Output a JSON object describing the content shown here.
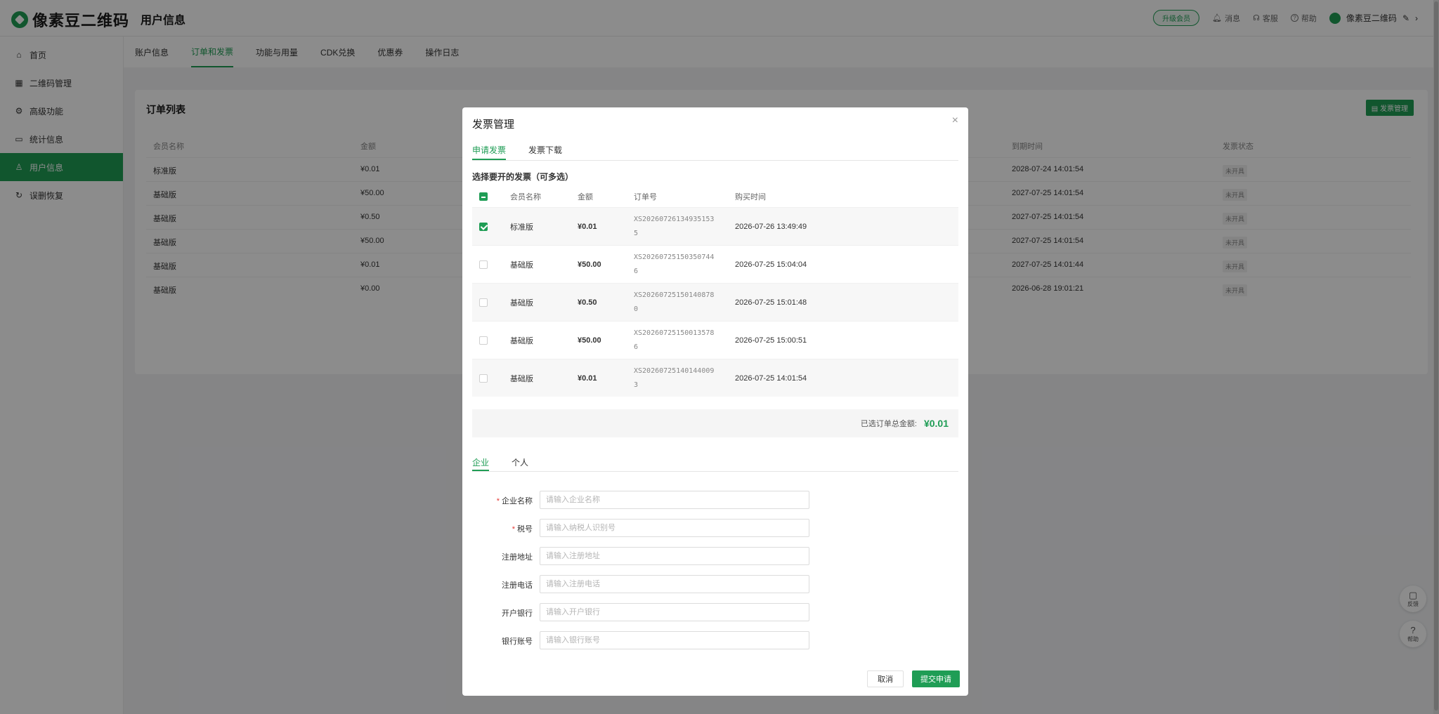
{
  "app": {
    "brand": "像素豆二维码",
    "page_title": "用户信息"
  },
  "topbar": {
    "upgrade": "升级会员",
    "message": "消息",
    "service": "客服",
    "help": "帮助",
    "user_name": "像素豆二维码"
  },
  "sidebar": {
    "items": [
      {
        "label": "首页",
        "icon": "home-icon"
      },
      {
        "label": "二维码管理",
        "icon": "grid-icon"
      },
      {
        "label": "高级功能",
        "icon": "gear-icon"
      },
      {
        "label": "统计信息",
        "icon": "chart-icon"
      },
      {
        "label": "用户信息",
        "icon": "user-icon"
      },
      {
        "label": "误删恢复",
        "icon": "restore-icon"
      }
    ],
    "active_index": 4
  },
  "subtabs": [
    "账户信息",
    "订单和发票",
    "功能与用量",
    "CDK兑换",
    "优惠券",
    "操作日志"
  ],
  "order_list": {
    "title": "订单列表",
    "action_button": "发票管理",
    "columns": [
      "会员名称",
      "金额",
      "到期时间",
      "发票状态"
    ],
    "rows": [
      {
        "name": "标准版",
        "amount": "¥0.01",
        "expire": "2028-07-24 14:01:54",
        "status": "未开具"
      },
      {
        "name": "基础版",
        "amount": "¥50.00",
        "expire": "2027-07-25 14:01:54",
        "status": "未开具"
      },
      {
        "name": "基础版",
        "amount": "¥0.50",
        "expire": "2027-07-25 14:01:54",
        "status": "未开具"
      },
      {
        "name": "基础版",
        "amount": "¥50.00",
        "expire": "2027-07-25 14:01:54",
        "status": "未开具"
      },
      {
        "name": "基础版",
        "amount": "¥0.01",
        "expire": "2027-07-25 14:01:44",
        "status": "未开具"
      },
      {
        "name": "基础版",
        "amount": "¥0.00",
        "expire": "2026-06-28 19:01:21",
        "status": "未开具"
      }
    ]
  },
  "float_tools": {
    "feedback": "反馈",
    "help": "帮助"
  },
  "modal": {
    "title": "发票管理",
    "tabs": [
      "申请发票",
      "发票下载"
    ],
    "select_hint": "选择要开的发票（可多选）",
    "table_columns": [
      "会员名称",
      "金额",
      "订单号",
      "购买时间"
    ],
    "orders": [
      {
        "checked": true,
        "name": "标准版",
        "amount": "¥0.01",
        "order_no": "XS202607261349351535",
        "time": "2026-07-26 13:49:49"
      },
      {
        "checked": false,
        "name": "基础版",
        "amount": "¥50.00",
        "order_no": "XS202607251503507446",
        "time": "2026-07-25 15:04:04"
      },
      {
        "checked": false,
        "name": "基础版",
        "amount": "¥0.50",
        "order_no": "XS202607251501408780",
        "time": "2026-07-25 15:01:48"
      },
      {
        "checked": false,
        "name": "基础版",
        "amount": "¥50.00",
        "order_no": "XS202607251500135786",
        "time": "2026-07-25 15:00:51"
      },
      {
        "checked": false,
        "name": "基础版",
        "amount": "¥0.01",
        "order_no": "XS202607251401440093",
        "time": "2026-07-25 14:01:54"
      }
    ],
    "total_label": "已选订单总金额:",
    "total_value": "¥0.01",
    "type_tabs": [
      "企业",
      "个人"
    ],
    "form": [
      {
        "label": "企业名称",
        "required": true,
        "placeholder": "请输入企业名称"
      },
      {
        "label": "税号",
        "required": true,
        "placeholder": "请输入纳税人识别号"
      },
      {
        "label": "注册地址",
        "required": false,
        "placeholder": "请输入注册地址"
      },
      {
        "label": "注册电话",
        "required": false,
        "placeholder": "请输入注册电话"
      },
      {
        "label": "开户银行",
        "required": false,
        "placeholder": "请输入开户银行"
      },
      {
        "label": "银行账号",
        "required": false,
        "placeholder": "请输入银行账号"
      }
    ],
    "cancel": "取消",
    "submit": "提交申请"
  },
  "colors": {
    "accent": "#1f9d55",
    "required": "#e53935"
  }
}
